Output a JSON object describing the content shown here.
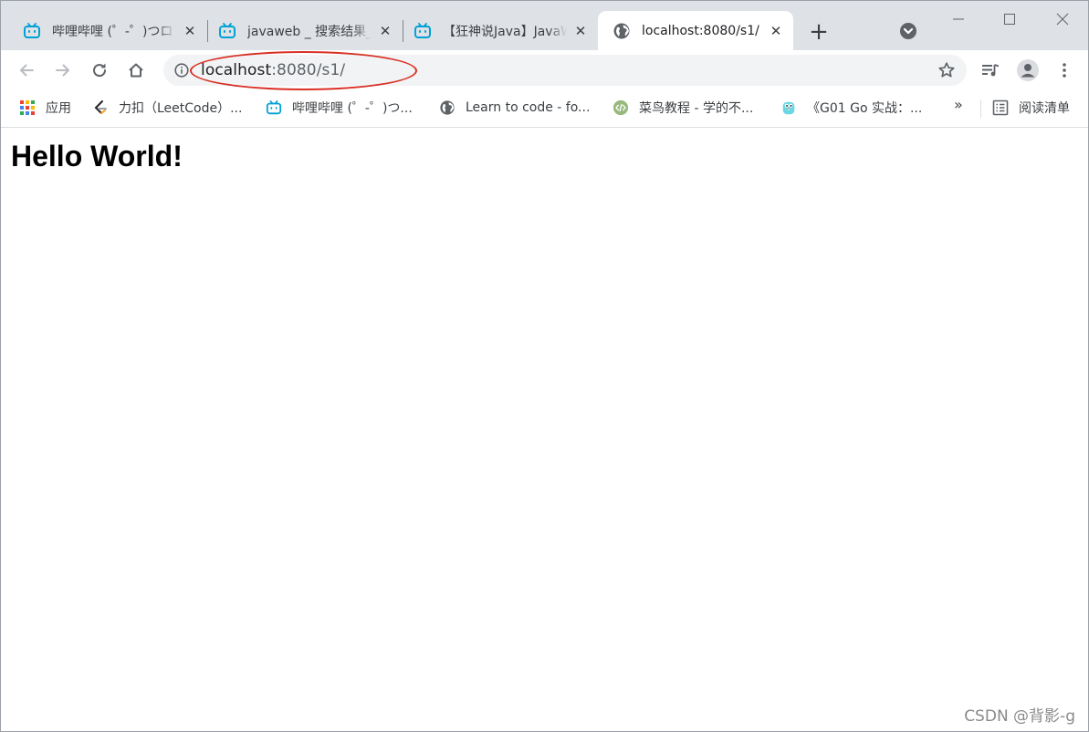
{
  "tabs": [
    {
      "title": "哔哩哔哩 (゜-゜)つロ 干杯~-bilibili",
      "icon": "bilibili-icon",
      "active": false
    },
    {
      "title": "javaweb _ 搜索结果_哔哩哔哩-bilibili",
      "icon": "bilibili-icon",
      "active": false
    },
    {
      "title": "【狂神说Java】JavaWeb入门到实战",
      "icon": "bilibili-icon",
      "active": false
    },
    {
      "title": "localhost:8080/s1/",
      "icon": "globe-icon",
      "active": true
    }
  ],
  "new_tab_label": "+",
  "address_bar": {
    "host": "localhost",
    "rest": ":8080/s1/"
  },
  "bookmarks": [
    {
      "label": "应用",
      "icon": "apps-grid-icon"
    },
    {
      "label": "力扣（LeetCode）...",
      "icon": "leetcode-icon"
    },
    {
      "label": "哔哩哔哩 (゜-゜)つ...",
      "icon": "bilibili-icon"
    },
    {
      "label": "Learn to code - fo...",
      "icon": "globe-icon"
    },
    {
      "label": "菜鸟教程 - 学的不...",
      "icon": "runoob-icon"
    },
    {
      "label": "《G01 Go 实战：...",
      "icon": "gopher-icon"
    }
  ],
  "bookmarks_overflow": "»",
  "reading_list_label": "阅读清单",
  "page": {
    "heading": "Hello World!"
  },
  "watermark": "CSDN @背影-g",
  "colors": {
    "tabstrip_bg": "#dee1e6",
    "omnibox_bg": "#f1f3f4",
    "annotation_red": "#d93025",
    "bilibili_blue": "#00a1d6"
  }
}
